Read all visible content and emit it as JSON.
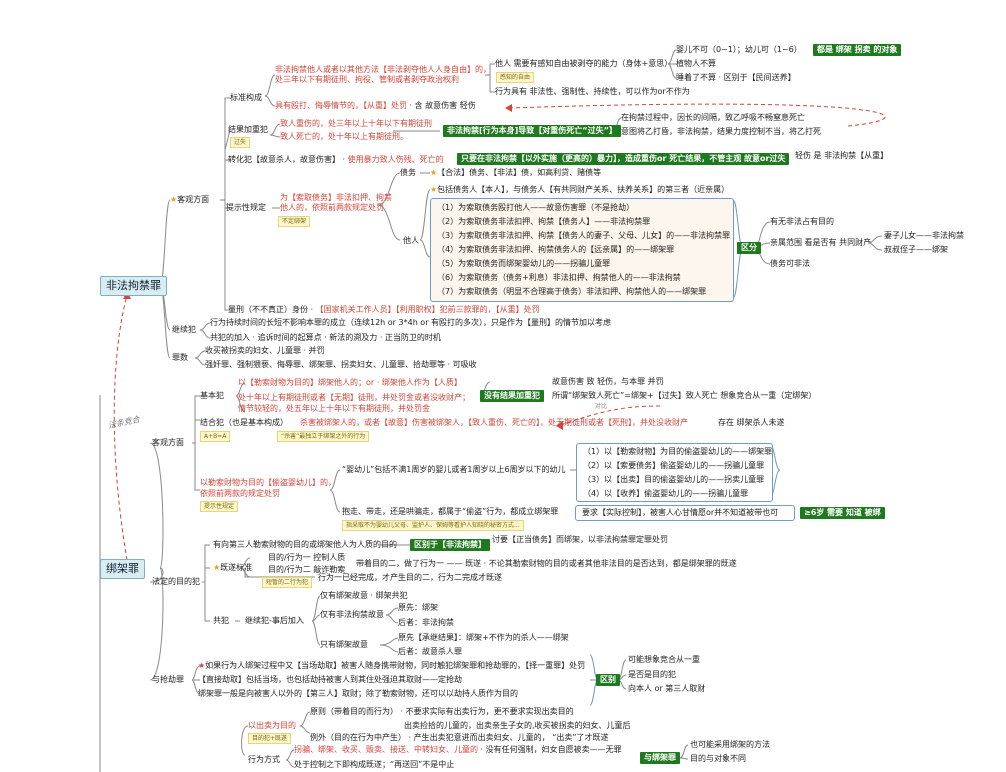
{
  "roots": {
    "illegal_detention": "非法拘禁罪",
    "kidnapping": "绑架罪",
    "competition_label": "法条竞合"
  },
  "id_branch": {
    "objective": "客观方面",
    "standard": "标准构成",
    "std_red_1": "非法拘禁他人或者以其他方法【非法剥夺他人人身自由】的，",
    "std_red_2": "处三年以下有期徒刑、拘役、管制或者剥夺政治权利",
    "std_beat_red": "具有殴打、侮辱情节的，【从重】处罚",
    "std_beat_tail": "含 故意伤害 轻伤",
    "other_need": "他人 需要有感知自由被剥夺的能力（身体+意思）",
    "note_sense": "感知的自由",
    "action_suff": "行为具有 非法性、强制性、持续性，可以作为or不作为",
    "infant": "婴儿不可（0~1）；幼儿可（1~6）",
    "vegetable": "植物人不算",
    "asleep": "睡着了不算",
    "from_hide": "区别于【民间送养】",
    "all_target": "都是 绑架 拐卖 的对象",
    "aggravated": "结果加重犯",
    "agg_1": "致人重伤的，处三年以上十年以下有期徒刑",
    "agg_2": "致人死亡的，处十年以上有期徒刑。",
    "note_fault": "过失",
    "agg_box": "非法拘禁[行为本身]导致【对重伤死亡“过失”】",
    "agg_exp_1": "在拘禁过程中，因长的间隔，致乙呼吸不畅窒息死亡",
    "agg_exp_2": "意图将乙打昏，非法拘禁，结果力度控制不当，将乙打死",
    "convert": "转化犯【故意杀人，故意伤害】",
    "convert_red": "使用暴力致人伤残、死亡的",
    "convert_box": "只要在非法拘禁【以外实施（更高的）暴力】，造成重伤or 死亡结果，不管主观 故意or过失",
    "convert_tail": "轻伤 是 非法拘禁【从重】",
    "hint": "提示性规定",
    "hint_red_1": "为【索取债务】非法扣押、拘禁",
    "hint_red_2": "他人的，依照前两款规定处罚",
    "note_no_kidnap": "不定绑架",
    "debt": "债务",
    "debt_desc": "【合法】债务、【非法】债，如高利贷、赌债等",
    "others": "他人",
    "others_desc": "包括债务人【本人】，与债务人【有共同财产关系、扶养关系】的第三者（近亲属）",
    "cases": [
      "（1）为索取债务殴打他人——故意伤害罪（不是抢劫）",
      "（2）为索取债务非法扣押、拘禁【债务人】——非法拘禁罪",
      "（3）为索取债务非法扣押、拘禁【债务人的妻子、父母、儿女】的——非法拘禁罪",
      "（4）为索取债务非法扣押、拘禁债务人的【远亲属】的——绑架罪",
      "（5）为索取债务而绑架婴幼儿的——拐骗儿童罪",
      "（6）为索取债务（债务+利息）非法扣押、拘禁他人的——非法拘禁",
      "（7）为索取债务（明显不合理高于债务）非法扣押、拘禁他人的——绑架罪"
    ],
    "distinguish": "区分",
    "dist_1": "有无非法占有目的",
    "dist_2": "亲属范围 看是否有 共同财产",
    "dist_3": "债务可非法",
    "rel_1": "妻子儿女——非法拘禁",
    "rel_2": "叔叔侄子——绑架",
    "severe": "量刑（不不真正）身份",
    "severe_red": "【国家机关工作人员】【利用职权】犯前三款罪的，【从重】处罚",
    "continuing": "继续犯",
    "cont_1": "行为持续时间的长短不影响本罪的成立（连续12h or 3*4h or 有殴打的多次），只是作为【量刑】的情节加以考虑",
    "cont_2": "共犯的加入",
    "cont_2b": "追诉时间的起算点",
    "cont_2c": "新法的溯及力",
    "cont_2d": "正当防卫的时机",
    "counts": "罪数",
    "counts_1": "收买被拐卖的妇女、儿童罪",
    "counts_1b": "并罚",
    "counts_2": "强奸罪、强制猥亵、侮辱罪、绑架罪、拐卖妇女、儿童罪、拾劫罪等",
    "counts_2b": "可吸收"
  },
  "kd_branch": {
    "objective": "客观方面",
    "basic": "基本犯",
    "basic_red_1": "以【勒索财物为目的】绑架他人的；or",
    "basic_red_1b": "绑架他人作为【人质】",
    "basic_red_2": "处十年以上有期徒刑或者【无期】徒刑，并处罚金或者没收财产；",
    "basic_red_3": "情节较轻的，处五年以上十年以下有期徒刑，并处罚金",
    "note_a4a": "A+B=A",
    "no_result": "没有结果加重犯",
    "nr_1": "故意伤害 致 轻伤，与本罪 并罚",
    "nr_2": "所谓“绑架致人死亡”=绑架+【过失】致人死亡 想象竞合从一重（定绑架）",
    "contrast": "对比",
    "combined": "结合犯（也是基本构成）",
    "combined_red": "杀害被绑架人的，或者【故意】伤害被绑架人，【致人重伤、死亡的】，处无期徒刑或者【死刑】，并处没收财产",
    "combined_tail": "存在 绑架杀人未遂",
    "note_kill": "“杀害”最独立于绑架之外的行为",
    "hint_red_1": "以勒索财物为目的【偷盗婴幼儿】的，",
    "hint_red_2": "依照前两款的规定处罚",
    "note_hint": "提示性规定",
    "infant_def": "“婴幼儿”包括不满1周岁的婴儿或者1周岁以上6周岁以下的幼儿",
    "infant_cases": [
      "（1）以【勒索财物】为目的偷盗婴幼儿的——绑架罪",
      "（2）以【索要债务】偷盗婴幼儿的——拐骗儿童罪",
      "（3）以【出卖】目的偷盗婴幼儿的——拐卖儿童罪",
      "（4）以【收养】偷盗婴幼儿的——拐骗儿童罪"
    ],
    "steal": "抱走、带走，还是哄骗走，都属于“偷盗”行为，都成立绑架罪",
    "steal_req": "要求【实际控制】，被害人心甘情愿or并不知道被带也可",
    "age_box": "≥6岁 需要 知道 被绑",
    "note_steal": "指采取不为婴幼儿父母、监护人、保姆等看护人知晓的秘密方式...",
    "purpose": "法定的目的犯",
    "third": "有向第三人勒索财物的目的或绑架他人为人质的目的",
    "diff_illegal": "区别于【非法拘禁】",
    "diff_illegal_tail": "讨要【正当债务】而绑架，以非法拘禁罪定罪处罚",
    "star_standard": "既遂标准",
    "purpose_1": "目的/行为一 控制人质",
    "purpose_2": "目的/行为二 敲诈勒索",
    "purpose_tail": "带着目的二，做了行为一",
    "purpose_tail2": "既遂",
    "purpose_tail3": "不论其勒索财物的目的或者其他非法目的是否达到，都是绑架罪的既遂",
    "note_short": "短暂的二行为犯",
    "purpose_3": "行为一已经完成，才产生目的二，行为二完成才既遂",
    "accomplice": "共犯",
    "acc_cont": "继续犯-事后加入",
    "acc_only_k": "仅有绑架故意",
    "acc_only_k_tail": "绑架共犯",
    "acc_only_i": "仅有非法拘禁故意",
    "acc_orig_1": "原先：绑架",
    "acc_later_1": "后者：非法拘禁",
    "acc_only_h": "只有绑架故意",
    "acc_orig_2": "原先【承继结果】：绑架+不作为的杀人——绑架",
    "acc_later_2": "后者：故意杀人罪",
    "robbery": "与抢劫罪",
    "rob_1_red": "如果行为人绑架过程中又【当场劫取】被害人随身携带财物，同时触犯绑架罪和抢劫罪的，【择一重罪】处罚",
    "rob_2": "【直接劫取】包括当场，也包括劫持被害人到其住处强迫其取财——定抢劫",
    "rob_3": "绑架罪一般是向被害人以外的【第三人】取财；除了勒索财物，还可以以劫持人质作为目的",
    "rob_dist": "区别",
    "rob_d1": "可能想象竞合从一重",
    "rob_d2": "是否是目的犯",
    "rob_d3": "向本人 or 第三人取财"
  },
  "bottom": {
    "sale_purpose": "以出卖为目的",
    "note_purpose": "目的犯+既遂",
    "sale_1": "原则（带着目的而行为）",
    "sale_1b": "不要求实际有出卖行为，更不要求实现出卖目的",
    "sale_2": "出卖捡拾的儿童的，出卖亲生子女的,收买被拐卖的妇女、儿童后",
    "sale_2b": "例外（目的在行为中产生）",
    "sale_2c": "产生出卖犯意进而出卖妇女、儿童的，",
    "sale_2d": "“出卖”了才既遂",
    "method": "行为方式",
    "method_red": "拐骗、绑架、收买、贩卖、接送、中转妇女、儿童的",
    "method_tail": "没有任何强制，妇女自愿被卖——无罪",
    "method_2": "处于控制之下即构成既遂；“再送回”不是中止",
    "with_kd": "与绑架罪",
    "wk_1": "也可能采用绑架的方法",
    "wk_2": "目的与对象不同"
  }
}
